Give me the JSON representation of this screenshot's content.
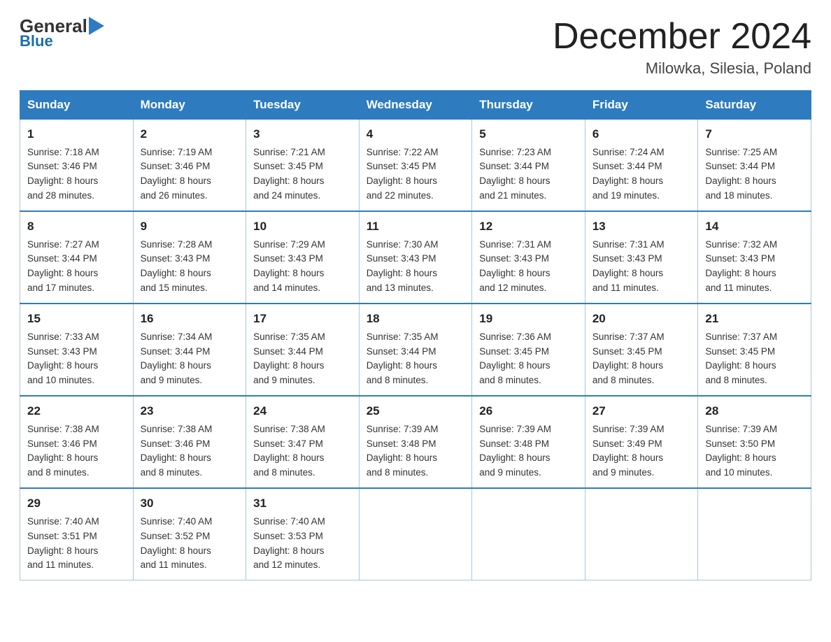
{
  "logo": {
    "general": "General",
    "blue": "Blue"
  },
  "header": {
    "title": "December 2024",
    "subtitle": "Milowka, Silesia, Poland"
  },
  "days_of_week": [
    "Sunday",
    "Monday",
    "Tuesday",
    "Wednesday",
    "Thursday",
    "Friday",
    "Saturday"
  ],
  "weeks": [
    [
      {
        "day": "1",
        "info": "Sunrise: 7:18 AM\nSunset: 3:46 PM\nDaylight: 8 hours\nand 28 minutes."
      },
      {
        "day": "2",
        "info": "Sunrise: 7:19 AM\nSunset: 3:46 PM\nDaylight: 8 hours\nand 26 minutes."
      },
      {
        "day": "3",
        "info": "Sunrise: 7:21 AM\nSunset: 3:45 PM\nDaylight: 8 hours\nand 24 minutes."
      },
      {
        "day": "4",
        "info": "Sunrise: 7:22 AM\nSunset: 3:45 PM\nDaylight: 8 hours\nand 22 minutes."
      },
      {
        "day": "5",
        "info": "Sunrise: 7:23 AM\nSunset: 3:44 PM\nDaylight: 8 hours\nand 21 minutes."
      },
      {
        "day": "6",
        "info": "Sunrise: 7:24 AM\nSunset: 3:44 PM\nDaylight: 8 hours\nand 19 minutes."
      },
      {
        "day": "7",
        "info": "Sunrise: 7:25 AM\nSunset: 3:44 PM\nDaylight: 8 hours\nand 18 minutes."
      }
    ],
    [
      {
        "day": "8",
        "info": "Sunrise: 7:27 AM\nSunset: 3:44 PM\nDaylight: 8 hours\nand 17 minutes."
      },
      {
        "day": "9",
        "info": "Sunrise: 7:28 AM\nSunset: 3:43 PM\nDaylight: 8 hours\nand 15 minutes."
      },
      {
        "day": "10",
        "info": "Sunrise: 7:29 AM\nSunset: 3:43 PM\nDaylight: 8 hours\nand 14 minutes."
      },
      {
        "day": "11",
        "info": "Sunrise: 7:30 AM\nSunset: 3:43 PM\nDaylight: 8 hours\nand 13 minutes."
      },
      {
        "day": "12",
        "info": "Sunrise: 7:31 AM\nSunset: 3:43 PM\nDaylight: 8 hours\nand 12 minutes."
      },
      {
        "day": "13",
        "info": "Sunrise: 7:31 AM\nSunset: 3:43 PM\nDaylight: 8 hours\nand 11 minutes."
      },
      {
        "day": "14",
        "info": "Sunrise: 7:32 AM\nSunset: 3:43 PM\nDaylight: 8 hours\nand 11 minutes."
      }
    ],
    [
      {
        "day": "15",
        "info": "Sunrise: 7:33 AM\nSunset: 3:43 PM\nDaylight: 8 hours\nand 10 minutes."
      },
      {
        "day": "16",
        "info": "Sunrise: 7:34 AM\nSunset: 3:44 PM\nDaylight: 8 hours\nand 9 minutes."
      },
      {
        "day": "17",
        "info": "Sunrise: 7:35 AM\nSunset: 3:44 PM\nDaylight: 8 hours\nand 9 minutes."
      },
      {
        "day": "18",
        "info": "Sunrise: 7:35 AM\nSunset: 3:44 PM\nDaylight: 8 hours\nand 8 minutes."
      },
      {
        "day": "19",
        "info": "Sunrise: 7:36 AM\nSunset: 3:45 PM\nDaylight: 8 hours\nand 8 minutes."
      },
      {
        "day": "20",
        "info": "Sunrise: 7:37 AM\nSunset: 3:45 PM\nDaylight: 8 hours\nand 8 minutes."
      },
      {
        "day": "21",
        "info": "Sunrise: 7:37 AM\nSunset: 3:45 PM\nDaylight: 8 hours\nand 8 minutes."
      }
    ],
    [
      {
        "day": "22",
        "info": "Sunrise: 7:38 AM\nSunset: 3:46 PM\nDaylight: 8 hours\nand 8 minutes."
      },
      {
        "day": "23",
        "info": "Sunrise: 7:38 AM\nSunset: 3:46 PM\nDaylight: 8 hours\nand 8 minutes."
      },
      {
        "day": "24",
        "info": "Sunrise: 7:38 AM\nSunset: 3:47 PM\nDaylight: 8 hours\nand 8 minutes."
      },
      {
        "day": "25",
        "info": "Sunrise: 7:39 AM\nSunset: 3:48 PM\nDaylight: 8 hours\nand 8 minutes."
      },
      {
        "day": "26",
        "info": "Sunrise: 7:39 AM\nSunset: 3:48 PM\nDaylight: 8 hours\nand 9 minutes."
      },
      {
        "day": "27",
        "info": "Sunrise: 7:39 AM\nSunset: 3:49 PM\nDaylight: 8 hours\nand 9 minutes."
      },
      {
        "day": "28",
        "info": "Sunrise: 7:39 AM\nSunset: 3:50 PM\nDaylight: 8 hours\nand 10 minutes."
      }
    ],
    [
      {
        "day": "29",
        "info": "Sunrise: 7:40 AM\nSunset: 3:51 PM\nDaylight: 8 hours\nand 11 minutes."
      },
      {
        "day": "30",
        "info": "Sunrise: 7:40 AM\nSunset: 3:52 PM\nDaylight: 8 hours\nand 11 minutes."
      },
      {
        "day": "31",
        "info": "Sunrise: 7:40 AM\nSunset: 3:53 PM\nDaylight: 8 hours\nand 12 minutes."
      },
      {
        "day": "",
        "info": ""
      },
      {
        "day": "",
        "info": ""
      },
      {
        "day": "",
        "info": ""
      },
      {
        "day": "",
        "info": ""
      }
    ]
  ]
}
